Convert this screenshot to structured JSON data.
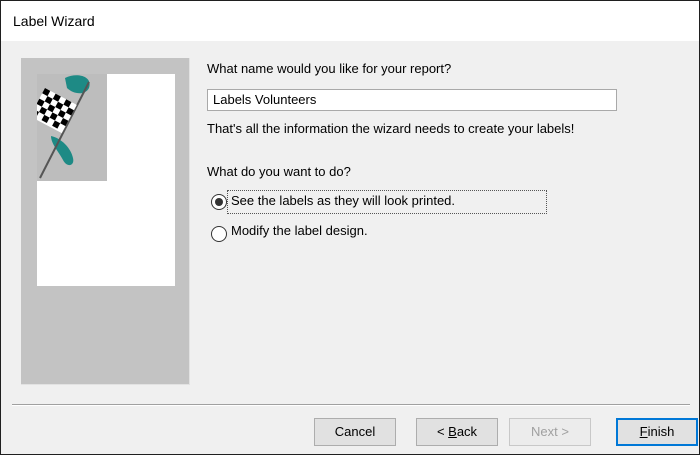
{
  "window": {
    "title": "Label Wizard"
  },
  "main": {
    "name_prompt": "What name would you like for your report?",
    "report_name_value": "Labels Volunteers",
    "info_text": "That's all the information the wizard needs to create your labels!",
    "action_prompt": "What do you want to do?",
    "options": [
      {
        "label": "See the labels as they will look printed.",
        "selected": true
      },
      {
        "label": "Modify the label design.",
        "selected": false
      }
    ]
  },
  "buttons": {
    "cancel": "Cancel",
    "back_prefix": "< ",
    "back_accel": "B",
    "back_rest": "ack",
    "next": "Next >",
    "finish_accel": "F",
    "finish_rest": "inish"
  },
  "icons": {
    "wizard_image": "checkered-flag-icon"
  },
  "colors": {
    "teal_brush": "#1e8a85",
    "panel_gray": "#c3c3c3",
    "focus_blue": "#0078d7"
  }
}
